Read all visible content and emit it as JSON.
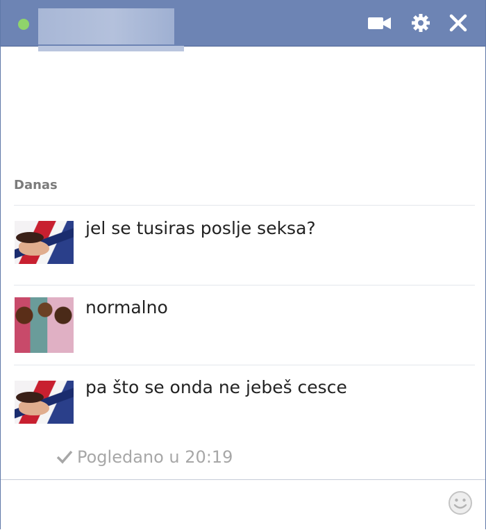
{
  "header": {
    "contact_name": "",
    "status": "online",
    "icons": [
      "video-camera-icon",
      "gear-icon",
      "close-icon"
    ]
  },
  "conversation": {
    "day_label": "Danas",
    "messages": [
      {
        "avatar": "contact-avatar",
        "text": "jel se tusiras poslje seksa?"
      },
      {
        "avatar": "own-avatar",
        "text": "normalno"
      },
      {
        "avatar": "contact-avatar",
        "text": "pa što se onda ne jebeš cesce"
      }
    ],
    "seen_text": "Pogledano u 20:19"
  },
  "composer": {
    "emoji_icon": "smiley-icon"
  },
  "colors": {
    "titlebar": "#6d84b4",
    "online": "#8fd46b",
    "seen_text": "#a7a7a7"
  }
}
